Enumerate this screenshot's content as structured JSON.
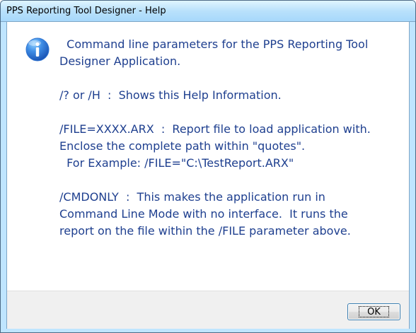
{
  "window": {
    "title": "PPS Reporting Tool Designer - Help"
  },
  "message": {
    "lines": [
      "  Command line parameters for the PPS Reporting Tool",
      "Designer Application.",
      "",
      "/? or /H  :  Shows this Help Information.",
      "",
      "/FILE=XXXX.ARX  :  Report file to load application with.",
      "Enclose the complete path within \"quotes\".",
      "  For Example: /FILE=\"C:\\TestReport.ARX\"",
      "",
      "/CMDONLY  :  This makes the application run in",
      "Command Line Mode with no interface.  It runs the",
      "report on the file within the /FILE parameter above."
    ]
  },
  "buttons": {
    "ok_label": "OK"
  },
  "icons": {
    "information": "information-icon"
  },
  "colors": {
    "message_text": "#1e3f8f",
    "icon_blue": "#2f74d0",
    "title_bar": "#bfe5ff",
    "dialog_background": "#ffffff",
    "footer_background": "#f0f0f0"
  }
}
